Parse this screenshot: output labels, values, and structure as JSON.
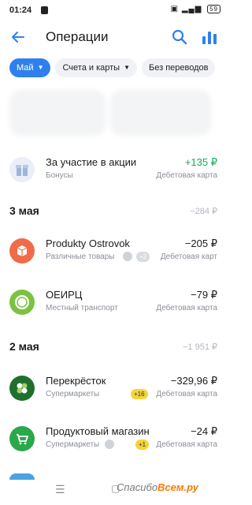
{
  "status": {
    "time": "01:24",
    "battery": "59"
  },
  "appbar": {
    "title": "Операции"
  },
  "chips": [
    {
      "label": "Май"
    },
    {
      "label": "Счета и карты"
    },
    {
      "label": "Без переводов"
    }
  ],
  "rows": {
    "promo": {
      "name": "За участие в акции",
      "category": "Бонусы",
      "amount": "+135 ₽",
      "account": "Дебетовая карта"
    },
    "produkty": {
      "name": "Produkty Ostrovok",
      "category": "Различные товары",
      "badge": "+2",
      "amount": "−205 ₽",
      "account": "Дебетовая карт"
    },
    "oeirc": {
      "name": "ОЕИРЦ",
      "category": "Местный транспорт",
      "amount": "−79 ₽",
      "account": "Дебетовая карта"
    },
    "perekrestok": {
      "name": "Перекрёсток",
      "category": "Супермаркеты",
      "badge": "+16",
      "amount": "−329,96 ₽",
      "account": "Дебетовая карта"
    },
    "magazin": {
      "name": "Продуктовый магазин",
      "category": "Супермаркеты",
      "badge": "+1",
      "amount": "−24 ₽",
      "account": "Дебетовая карта"
    }
  },
  "days": {
    "may3": {
      "date": "3 мая",
      "sum": "−284 ₽"
    },
    "may2": {
      "date": "2 мая",
      "sum": "−1 951 ₽"
    }
  },
  "watermark": {
    "text": "Спасибо",
    "brand": "Всем.ру"
  },
  "colors": {
    "accent": "#2f80ed",
    "positive": "#18a957",
    "muted": "#8a8f98"
  }
}
